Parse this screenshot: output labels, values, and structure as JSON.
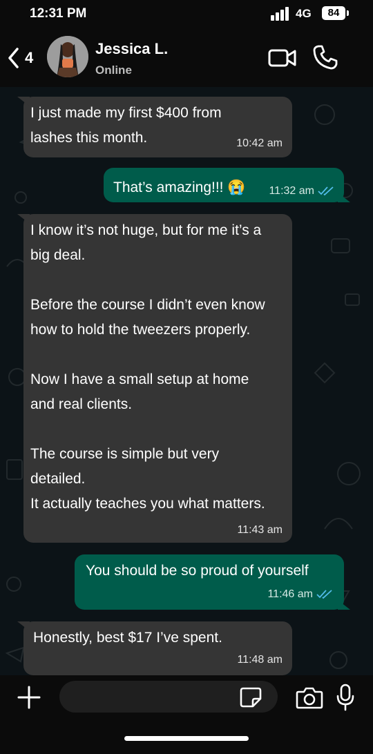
{
  "status_bar": {
    "time": "12:31 PM",
    "network": "4G",
    "battery": "84"
  },
  "header": {
    "back_count": "4",
    "contact_name": "Jessica L.",
    "contact_status": "Online"
  },
  "messages": [
    {
      "direction": "in",
      "text": "I just made my first $400 from\nlashes this month.",
      "time": "10:42 am"
    },
    {
      "direction": "out",
      "text": "That’s amazing!!! 😭",
      "time": "11:32 am",
      "read": true
    },
    {
      "direction": "in",
      "text": "I know it’s not huge, but for me it’s a\nbig deal.\n\nBefore the course I didn’t even know\nhow to hold the tweezers properly.\n\nNow I have a small setup at home\nand real clients.\n\nThe course is simple but very\ndetailed.\nIt actually teaches you what matters.",
      "time": "11:43 am"
    },
    {
      "direction": "out",
      "text": "You should be so proud of yourself",
      "time": "11:46 am",
      "read": true
    },
    {
      "direction": "in",
      "text": "Honestly, best $17 I’ve spent.",
      "time": "11:48 am"
    }
  ],
  "input": {
    "value": "",
    "placeholder": ""
  },
  "colors": {
    "incoming_bubble": "#353535",
    "outgoing_bubble": "#005c4b",
    "read_ticks": "#53bdeb",
    "chat_background": "#0c1317"
  },
  "icons": {
    "back": "chevron-left-icon",
    "video": "video-camera-icon",
    "call": "phone-icon",
    "add": "plus-icon",
    "sticker": "sticker-icon",
    "camera": "camera-icon",
    "mic": "microphone-icon"
  }
}
